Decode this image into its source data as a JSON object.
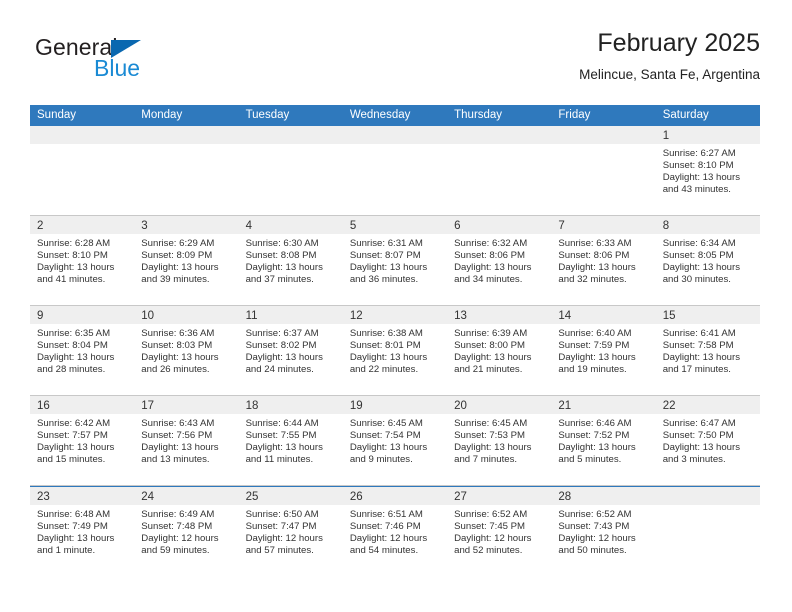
{
  "brand": {
    "word1": "General",
    "word2": "Blue",
    "triangle_color": "#0a68b0",
    "word2_color": "#1a8ad4"
  },
  "header": {
    "title": "February 2025",
    "subtitle": "Melincue, Santa Fe, Argentina"
  },
  "theme": {
    "header_blue": "#2f79bd",
    "band_gray": "#efefef",
    "row_divider": "#c8c8c8"
  },
  "weekdays": [
    "Sunday",
    "Monday",
    "Tuesday",
    "Wednesday",
    "Thursday",
    "Friday",
    "Saturday"
  ],
  "weeks": [
    [
      {
        "num": "",
        "empty": true,
        "lines": []
      },
      {
        "num": "",
        "empty": true,
        "lines": []
      },
      {
        "num": "",
        "empty": true,
        "lines": []
      },
      {
        "num": "",
        "empty": true,
        "lines": []
      },
      {
        "num": "",
        "empty": true,
        "lines": []
      },
      {
        "num": "",
        "empty": true,
        "lines": []
      },
      {
        "num": "1",
        "empty": false,
        "lines": [
          "Sunrise: 6:27 AM",
          "Sunset: 8:10 PM",
          "Daylight: 13 hours",
          "and 43 minutes."
        ]
      }
    ],
    [
      {
        "num": "2",
        "empty": false,
        "lines": [
          "Sunrise: 6:28 AM",
          "Sunset: 8:10 PM",
          "Daylight: 13 hours",
          "and 41 minutes."
        ]
      },
      {
        "num": "3",
        "empty": false,
        "lines": [
          "Sunrise: 6:29 AM",
          "Sunset: 8:09 PM",
          "Daylight: 13 hours",
          "and 39 minutes."
        ]
      },
      {
        "num": "4",
        "empty": false,
        "lines": [
          "Sunrise: 6:30 AM",
          "Sunset: 8:08 PM",
          "Daylight: 13 hours",
          "and 37 minutes."
        ]
      },
      {
        "num": "5",
        "empty": false,
        "lines": [
          "Sunrise: 6:31 AM",
          "Sunset: 8:07 PM",
          "Daylight: 13 hours",
          "and 36 minutes."
        ]
      },
      {
        "num": "6",
        "empty": false,
        "lines": [
          "Sunrise: 6:32 AM",
          "Sunset: 8:06 PM",
          "Daylight: 13 hours",
          "and 34 minutes."
        ]
      },
      {
        "num": "7",
        "empty": false,
        "lines": [
          "Sunrise: 6:33 AM",
          "Sunset: 8:06 PM",
          "Daylight: 13 hours",
          "and 32 minutes."
        ]
      },
      {
        "num": "8",
        "empty": false,
        "lines": [
          "Sunrise: 6:34 AM",
          "Sunset: 8:05 PM",
          "Daylight: 13 hours",
          "and 30 minutes."
        ]
      }
    ],
    [
      {
        "num": "9",
        "empty": false,
        "lines": [
          "Sunrise: 6:35 AM",
          "Sunset: 8:04 PM",
          "Daylight: 13 hours",
          "and 28 minutes."
        ]
      },
      {
        "num": "10",
        "empty": false,
        "lines": [
          "Sunrise: 6:36 AM",
          "Sunset: 8:03 PM",
          "Daylight: 13 hours",
          "and 26 minutes."
        ]
      },
      {
        "num": "11",
        "empty": false,
        "lines": [
          "Sunrise: 6:37 AM",
          "Sunset: 8:02 PM",
          "Daylight: 13 hours",
          "and 24 minutes."
        ]
      },
      {
        "num": "12",
        "empty": false,
        "lines": [
          "Sunrise: 6:38 AM",
          "Sunset: 8:01 PM",
          "Daylight: 13 hours",
          "and 22 minutes."
        ]
      },
      {
        "num": "13",
        "empty": false,
        "lines": [
          "Sunrise: 6:39 AM",
          "Sunset: 8:00 PM",
          "Daylight: 13 hours",
          "and 21 minutes."
        ]
      },
      {
        "num": "14",
        "empty": false,
        "lines": [
          "Sunrise: 6:40 AM",
          "Sunset: 7:59 PM",
          "Daylight: 13 hours",
          "and 19 minutes."
        ]
      },
      {
        "num": "15",
        "empty": false,
        "lines": [
          "Sunrise: 6:41 AM",
          "Sunset: 7:58 PM",
          "Daylight: 13 hours",
          "and 17 minutes."
        ]
      }
    ],
    [
      {
        "num": "16",
        "empty": false,
        "lines": [
          "Sunrise: 6:42 AM",
          "Sunset: 7:57 PM",
          "Daylight: 13 hours",
          "and 15 minutes."
        ]
      },
      {
        "num": "17",
        "empty": false,
        "lines": [
          "Sunrise: 6:43 AM",
          "Sunset: 7:56 PM",
          "Daylight: 13 hours",
          "and 13 minutes."
        ]
      },
      {
        "num": "18",
        "empty": false,
        "lines": [
          "Sunrise: 6:44 AM",
          "Sunset: 7:55 PM",
          "Daylight: 13 hours",
          "and 11 minutes."
        ]
      },
      {
        "num": "19",
        "empty": false,
        "lines": [
          "Sunrise: 6:45 AM",
          "Sunset: 7:54 PM",
          "Daylight: 13 hours",
          "and 9 minutes."
        ]
      },
      {
        "num": "20",
        "empty": false,
        "lines": [
          "Sunrise: 6:45 AM",
          "Sunset: 7:53 PM",
          "Daylight: 13 hours",
          "and 7 minutes."
        ]
      },
      {
        "num": "21",
        "empty": false,
        "lines": [
          "Sunrise: 6:46 AM",
          "Sunset: 7:52 PM",
          "Daylight: 13 hours",
          "and 5 minutes."
        ]
      },
      {
        "num": "22",
        "empty": false,
        "lines": [
          "Sunrise: 6:47 AM",
          "Sunset: 7:50 PM",
          "Daylight: 13 hours",
          "and 3 minutes."
        ]
      }
    ],
    [
      {
        "num": "23",
        "empty": false,
        "lines": [
          "Sunrise: 6:48 AM",
          "Sunset: 7:49 PM",
          "Daylight: 13 hours",
          "and 1 minute."
        ]
      },
      {
        "num": "24",
        "empty": false,
        "lines": [
          "Sunrise: 6:49 AM",
          "Sunset: 7:48 PM",
          "Daylight: 12 hours",
          "and 59 minutes."
        ]
      },
      {
        "num": "25",
        "empty": false,
        "lines": [
          "Sunrise: 6:50 AM",
          "Sunset: 7:47 PM",
          "Daylight: 12 hours",
          "and 57 minutes."
        ]
      },
      {
        "num": "26",
        "empty": false,
        "lines": [
          "Sunrise: 6:51 AM",
          "Sunset: 7:46 PM",
          "Daylight: 12 hours",
          "and 54 minutes."
        ]
      },
      {
        "num": "27",
        "empty": false,
        "lines": [
          "Sunrise: 6:52 AM",
          "Sunset: 7:45 PM",
          "Daylight: 12 hours",
          "and 52 minutes."
        ]
      },
      {
        "num": "28",
        "empty": false,
        "lines": [
          "Sunrise: 6:52 AM",
          "Sunset: 7:43 PM",
          "Daylight: 12 hours",
          "and 50 minutes."
        ]
      },
      {
        "num": "",
        "empty": true,
        "lines": []
      }
    ]
  ]
}
